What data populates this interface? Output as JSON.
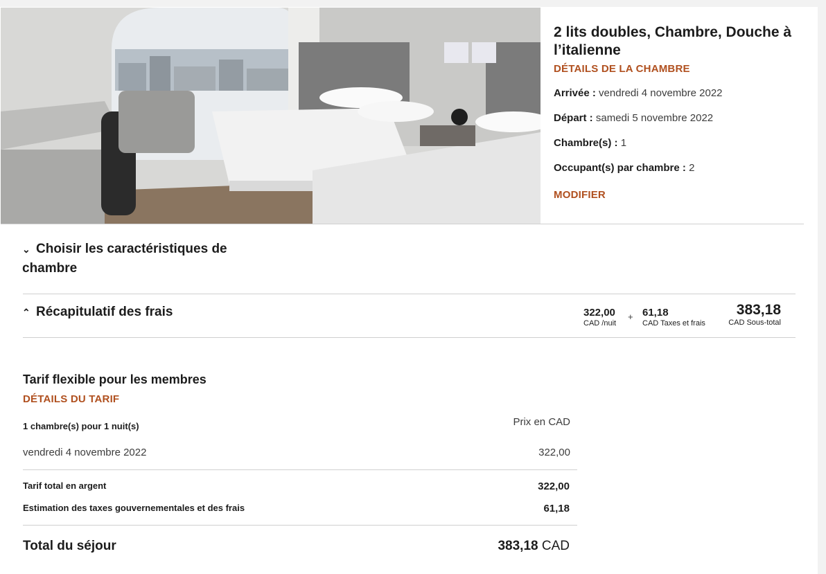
{
  "room": {
    "title": "2 lits doubles, Chambre, Douche à l’italienne",
    "details_link": "DÉTAILS DE LA CHAMBRE",
    "arrival_label": "Arrivée :",
    "arrival_value": "vendredi 4 novembre 2022",
    "departure_label": "Départ :",
    "departure_value": "samedi 5 novembre 2022",
    "rooms_label": "Chambre(s) :",
    "rooms_value": "1",
    "occupants_label": "Occupant(s) par chambre :",
    "occupants_value": "2",
    "modify_link": "MODIFIER"
  },
  "features_section": {
    "label": "Choisir les caractéristiques de chambre",
    "icon": "chevron-down-icon"
  },
  "fees_summary": {
    "label": "Récapitulatif des frais",
    "icon": "chevron-up-icon",
    "per_night_value": "322,00",
    "per_night_label": "CAD /nuit",
    "plus": "+",
    "taxes_value": "61,18",
    "taxes_label": "CAD Taxes et frais",
    "subtotal_value": "383,18",
    "subtotal_label": "CAD Sous-total"
  },
  "rate": {
    "title": "Tarif flexible pour les membres",
    "details_link": "DÉTAILS DU TARIF",
    "rooms_nights": "1 chambre(s) pour 1 nuit(s)",
    "price_currency": "Prix en CAD",
    "night_date": "vendredi 4 novembre 2022",
    "night_price": "322,00",
    "cash_total_label": "Tarif total en argent",
    "cash_total_value": "322,00",
    "taxes_label": "Estimation des taxes gouvernementales et des frais",
    "taxes_value": "61,18",
    "stay_total_label": "Total du séjour",
    "stay_total_value": "383,18",
    "stay_total_currency": "CAD"
  },
  "colors": {
    "accent": "#b0501f",
    "text": "#1c1c1c",
    "divider": "#cfcfcf"
  }
}
